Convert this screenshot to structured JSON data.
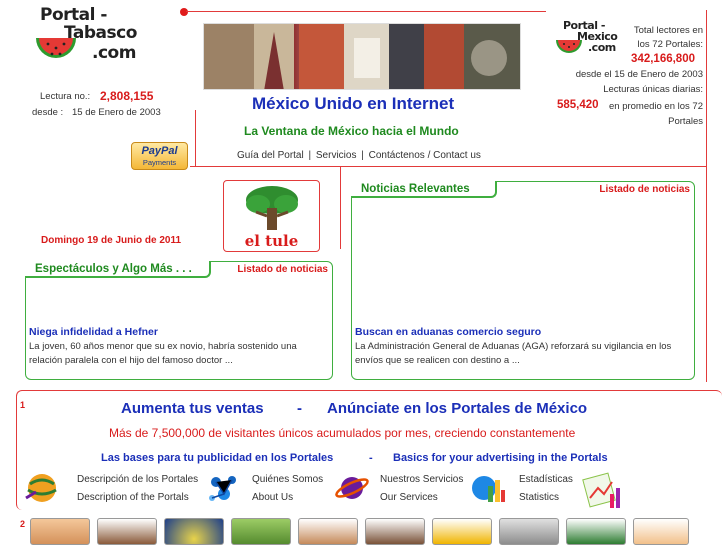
{
  "logo_left": {
    "line1": "Portal -",
    "line2": "Tabasco",
    "line3": ".com"
  },
  "lectura": {
    "label": "Lectura no.:",
    "value": "2,808,155",
    "desde_label": "desde :",
    "desde_value": "15 de Enero de 2003"
  },
  "header": {
    "title": "México Unido en Internet",
    "subtitle": "La Ventana de México hacia el Mundo"
  },
  "logo_right": {
    "line1": "Portal -",
    "line2": "Mexico",
    "line3": ".com"
  },
  "stats": {
    "line1": "Total lectores en",
    "line2": "los 72 Portales:",
    "total": "342,166,800",
    "since": "desde el 15 de Enero de 2003",
    "daily_label": "Lecturas únicas diarias:",
    "daily_value": "585,420",
    "daily_suffix": "en promedio en los 72",
    "daily_suffix2": "Portales"
  },
  "paypal": {
    "line1": "PayPal",
    "line2": "Payments"
  },
  "nav": {
    "items": [
      "Guía del Portal",
      "Servicios",
      "Contáctenos / Contact us"
    ],
    "separator": "|"
  },
  "date": "Domingo 19 de Junio de 2011",
  "tule": {
    "label": "el tule"
  },
  "news_right": {
    "tab": "Noticias Relevantes",
    "link": "Listado de noticias",
    "title": "Buscan en aduanas comercio seguro",
    "body1": "La Administración General de Aduanas (AGA) reforzará su vigilancia en los",
    "body2": "envíos que se realicen con destino a ..."
  },
  "news_left": {
    "tab": "Espectáculos y Algo Más . . .",
    "link": "Listado de noticias",
    "title": "Niega infidelidad a Hefner",
    "body1": "La joven, 60 años menor que su ex novio, habría sostenido una",
    "body2": "relación paralela con el hijo del famoso doctor ..."
  },
  "ad": {
    "index": "1",
    "headline_a": "Aumenta tus ventas",
    "headline_sep": "-",
    "headline_b": "Anúnciate en los Portales de México",
    "sub": "Más de 7,500,000 de visitantes únicos acumulados por mes, creciendo constantemente",
    "bases_es": "Las bases para tu publicidad en los Portales",
    "bases_sep": "-",
    "bases_en": "Basics for your advertising in the Portals",
    "features": [
      {
        "es": "Descripción de los Portales",
        "en": "Description of the Portals",
        "icon": "globe-icon"
      },
      {
        "es": "Quiénes Somos",
        "en": "About Us",
        "icon": "molecule-icon"
      },
      {
        "es": "Nuestros Servicios",
        "en": "Our Services",
        "icon": "planet-icon"
      },
      {
        "es": "Estadísticas",
        "en": "Statistics",
        "icon": "bar-chart-icon"
      }
    ]
  },
  "bottom_index": "2",
  "colors": {
    "brand_red": "#e23a3a",
    "link_blue": "#1b2fb8",
    "green": "#1f8a1f"
  }
}
